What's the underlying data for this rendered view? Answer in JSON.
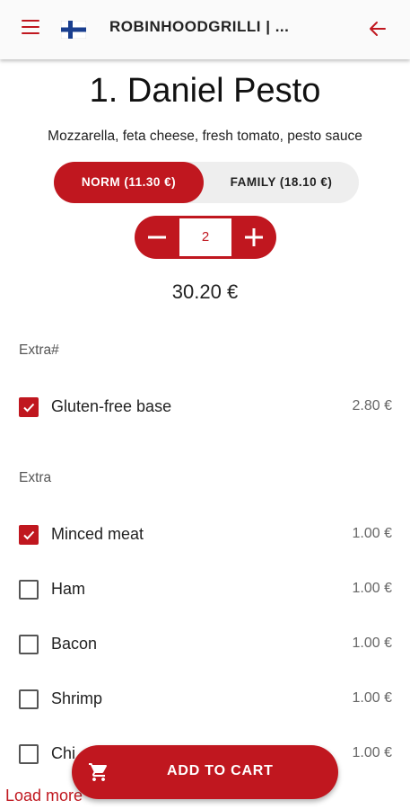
{
  "app_bar": {
    "title": "ROBINHOODGRILLI | ...",
    "icons": [
      "menu-icon",
      "finland-flag-icon",
      "back-arrow-icon"
    ],
    "accent_color": "#c0171f"
  },
  "product": {
    "title": "1. Daniel Pesto",
    "description": "Mozzarella, feta cheese, fresh tomato, pesto sauce"
  },
  "sizes": [
    {
      "label": "NORM (11.30 €)",
      "selected": true
    },
    {
      "label": "FAMILY (18.10 €)",
      "selected": false
    }
  ],
  "quantity": "2",
  "total": "30.20 €",
  "sections": [
    {
      "label": "Extra#",
      "options": [
        {
          "label": "Gluten-free base",
          "price": "2.80 €",
          "checked": true
        }
      ]
    },
    {
      "label": "Extra",
      "options": [
        {
          "label": "Minced meat",
          "price": "1.00 €",
          "checked": true
        },
        {
          "label": "Ham",
          "price": "1.00 €",
          "checked": false
        },
        {
          "label": "Bacon",
          "price": "1.00 €",
          "checked": false
        },
        {
          "label": "Shrimp",
          "price": "1.00 €",
          "checked": false
        },
        {
          "label": "Chi",
          "price": "1.00 €",
          "checked": false
        }
      ]
    }
  ],
  "add_to_cart": {
    "label": "ADD TO CART",
    "icon": "cart-icon"
  },
  "load_more": "Load more"
}
